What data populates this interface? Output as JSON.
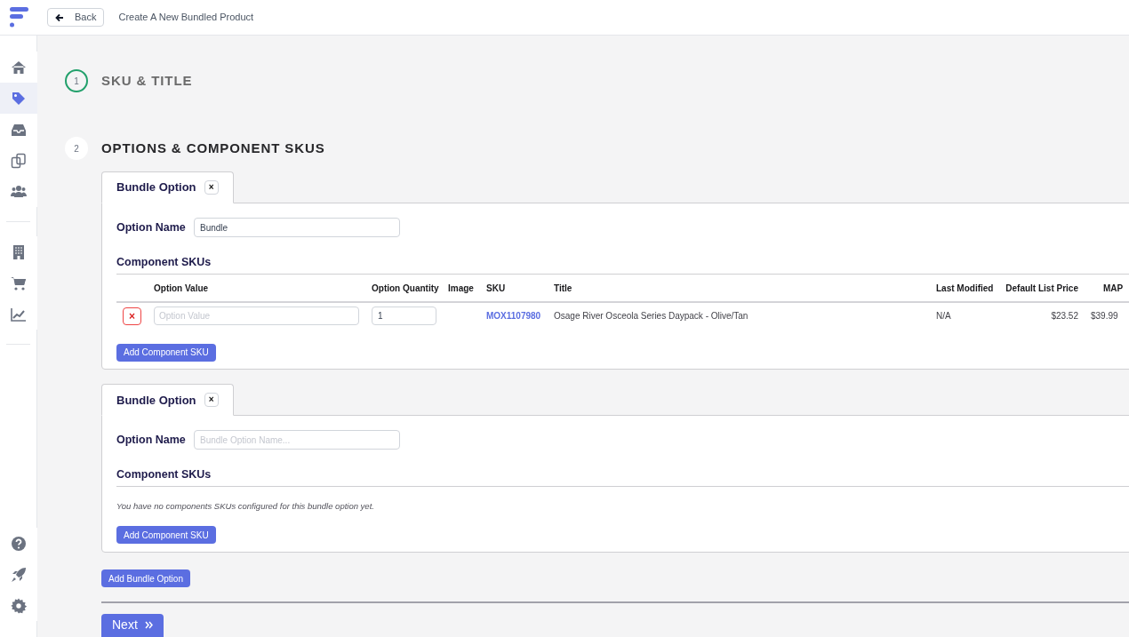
{
  "header": {
    "back_button": "Back",
    "title": "Create A New Bundled Product"
  },
  "sidebar": {
    "groups": [
      [
        {
          "selected": false
        },
        {
          "selected": true
        },
        {
          "selected": false
        },
        {
          "selected": false
        },
        {
          "selected": false
        }
      ],
      [
        {
          "selected": false
        },
        {
          "selected": false
        },
        {
          "selected": false
        }
      ]
    ],
    "bottom_items": [
      {
        "selected": false
      },
      {
        "selected": false
      },
      {
        "selected": false
      }
    ]
  },
  "steps": [
    {
      "number": "1",
      "title": "SKU & TITLE",
      "completed": true
    },
    {
      "number": "2",
      "title": "OPTIONS & COMPONENT SKUS",
      "completed": false
    }
  ],
  "bundle_options": [
    {
      "tab_label": "Bundle Option",
      "close": "×",
      "option_name_label": "Option Name",
      "option_name": {
        "value": "Bundle"
      },
      "components_heading": "Component SKUs",
      "table": {
        "columns": [
          "Option Value",
          "Option Quantity",
          "Image",
          "SKU",
          "Title",
          "Last Modified",
          "Default List Price",
          "MAP"
        ],
        "rows": [
          {
            "remove": "×",
            "option_value_placeholder": "Option Value",
            "quantity": "1",
            "sku": "MOX1107980",
            "title": "Osage River Osceola Series Daypack - Olive/Tan",
            "last_modified": "N/A",
            "default_list_price": "$23.52",
            "map": "$39.99"
          }
        ]
      },
      "add_button": "Add Component SKU"
    },
    {
      "tab_label": "Bundle Option",
      "close": "×",
      "option_name_label": "Option Name",
      "option_name": {
        "placeholder": "Bundle Option Name..."
      },
      "components_heading": "Component SKUs",
      "empty_message": "You have no components SKUs configured for this bundle option yet.",
      "add_button": "Add Component SKU"
    }
  ],
  "add_bundle_option": "Add Bundle Option",
  "next_button": "Next"
}
